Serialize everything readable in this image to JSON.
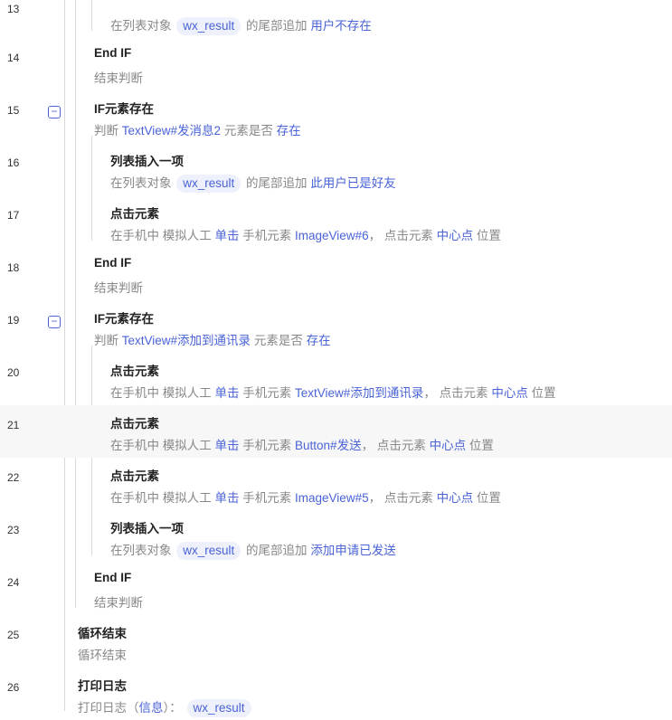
{
  "rows": [
    {
      "line": "13",
      "desc": [
        {
          "t": "在列表对象 "
        },
        {
          "t": "wx_result",
          "chip": true
        },
        {
          "t": " 的尾部追加 "
        },
        {
          "t": "用户不存在",
          "kw": true
        }
      ]
    },
    {
      "line": "14",
      "title": "End IF",
      "desc": [
        {
          "t": "结束判断"
        }
      ]
    },
    {
      "line": "15",
      "title": "IF元素存在",
      "desc": [
        {
          "t": "判断 "
        },
        {
          "t": "TextView#发消息2",
          "kw": true
        },
        {
          "t": " 元素是否 "
        },
        {
          "t": "存在",
          "kw": true
        }
      ]
    },
    {
      "line": "16",
      "title": "列表插入一项",
      "desc": [
        {
          "t": "在列表对象 "
        },
        {
          "t": "wx_result",
          "chip": true
        },
        {
          "t": " 的尾部追加 "
        },
        {
          "t": "此用户已是好友",
          "kw": true
        }
      ]
    },
    {
      "line": "17",
      "title": "点击元素",
      "desc": [
        {
          "t": "在手机中 模拟人工 "
        },
        {
          "t": "单击",
          "kw": true
        },
        {
          "t": " 手机元素 "
        },
        {
          "t": "ImageView#6",
          "kw": true
        },
        {
          "t": "，  点击元素 "
        },
        {
          "t": "中心点",
          "kw": true
        },
        {
          "t": " 位置"
        }
      ]
    },
    {
      "line": "18",
      "title": "End IF",
      "desc": [
        {
          "t": "结束判断"
        }
      ]
    },
    {
      "line": "19",
      "title": "IF元素存在",
      "desc": [
        {
          "t": "判断 "
        },
        {
          "t": "TextView#添加到通讯录",
          "kw": true
        },
        {
          "t": " 元素是否 "
        },
        {
          "t": "存在",
          "kw": true
        }
      ]
    },
    {
      "line": "20",
      "title": "点击元素",
      "desc": [
        {
          "t": "在手机中 模拟人工 "
        },
        {
          "t": "单击",
          "kw": true
        },
        {
          "t": " 手机元素 "
        },
        {
          "t": "TextView#添加到通讯录",
          "kw": true
        },
        {
          "t": "，  点击元素 "
        },
        {
          "t": "中心点",
          "kw": true
        },
        {
          "t": " 位置"
        }
      ]
    },
    {
      "line": "21",
      "title": "点击元素",
      "desc": [
        {
          "t": "在手机中 模拟人工 "
        },
        {
          "t": "单击",
          "kw": true
        },
        {
          "t": " 手机元素 "
        },
        {
          "t": "Button#发送",
          "kw": true
        },
        {
          "t": "，  点击元素 "
        },
        {
          "t": "中心点",
          "kw": true
        },
        {
          "t": " 位置"
        }
      ]
    },
    {
      "line": "22",
      "title": "点击元素",
      "desc": [
        {
          "t": "在手机中 模拟人工 "
        },
        {
          "t": "单击",
          "kw": true
        },
        {
          "t": " 手机元素 "
        },
        {
          "t": "ImageView#5",
          "kw": true
        },
        {
          "t": "，  点击元素 "
        },
        {
          "t": "中心点",
          "kw": true
        },
        {
          "t": " 位置"
        }
      ]
    },
    {
      "line": "23",
      "title": "列表插入一项",
      "desc": [
        {
          "t": "在列表对象 "
        },
        {
          "t": "wx_result",
          "chip": true
        },
        {
          "t": " 的尾部追加 "
        },
        {
          "t": "添加申请已发送",
          "kw": true
        }
      ]
    },
    {
      "line": "24",
      "title": "End IF",
      "desc": [
        {
          "t": "结束判断"
        }
      ]
    },
    {
      "line": "25",
      "title": "循环结束",
      "desc": [
        {
          "t": "循环结束"
        }
      ]
    },
    {
      "line": "26",
      "title": "打印日志",
      "desc": [
        {
          "t": "打印日志（"
        },
        {
          "t": "信息",
          "kw": true
        },
        {
          "t": "）： "
        },
        {
          "t": "wx_result",
          "chip": true
        }
      ]
    }
  ],
  "collapse_icon": "minus-square-icon",
  "colors": {
    "accent": "#4a63d6",
    "chip_bg": "#eef0fb",
    "title": "#222222",
    "desc": "#888888",
    "guide": "#d9d9d9",
    "highlight": "#f7f7f7"
  }
}
